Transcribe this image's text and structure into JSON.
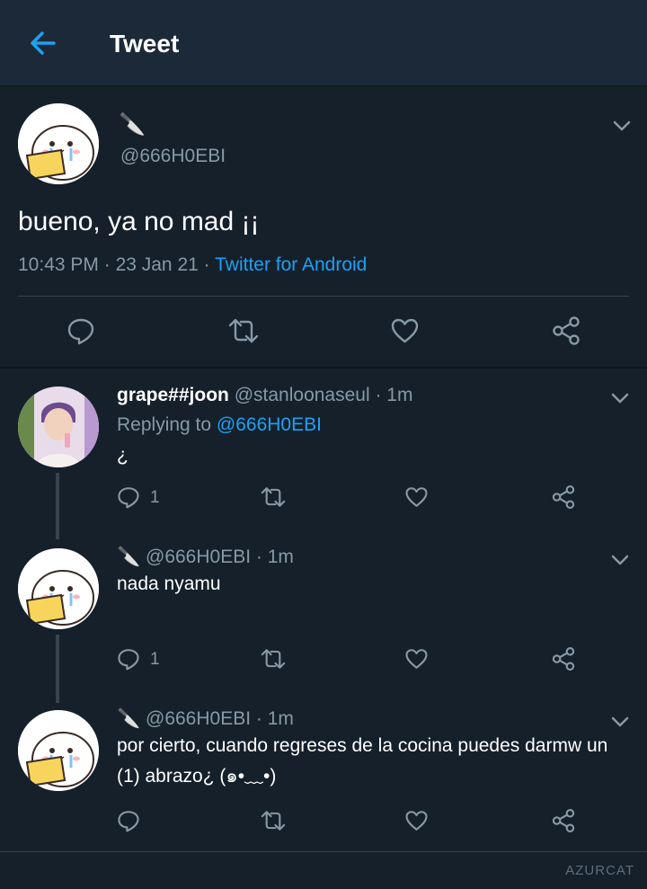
{
  "header": {
    "title": "Tweet",
    "back_icon": "arrow-left-icon"
  },
  "main_tweet": {
    "display_name": "🔪",
    "handle": "@666H0EBI",
    "text": "bueno, ya no mad ¡¡",
    "time": "10:43 PM",
    "date": "23 Jan 21",
    "separator": " · ",
    "source": "Twitter for Android"
  },
  "replies": [
    {
      "display_name": "grape##joon",
      "handle": "@stanloonaseul",
      "time": "· 1m",
      "replying_label": "Replying to ",
      "replying_to": "@666H0EBI",
      "text": "¿",
      "reply_count": "1"
    },
    {
      "display_name": "🔪",
      "handle": "@666H0EBI",
      "time": "· 1m",
      "text": "nada nyamu",
      "reply_count": "1"
    },
    {
      "display_name": "🔪",
      "handle": "@666H0EBI",
      "time": "· 1m",
      "text_line1": "por cierto, cuando regreses de la cocina puedes darmw un",
      "text_line2": "(1) abrazo¿ (๑•﹏•)"
    }
  ],
  "watermark": "AZURCAT",
  "colors": {
    "background": "#15202b",
    "header": "#1c2938",
    "accent": "#1da1f2",
    "muted": "#8899a6",
    "divider": "#38444d"
  }
}
